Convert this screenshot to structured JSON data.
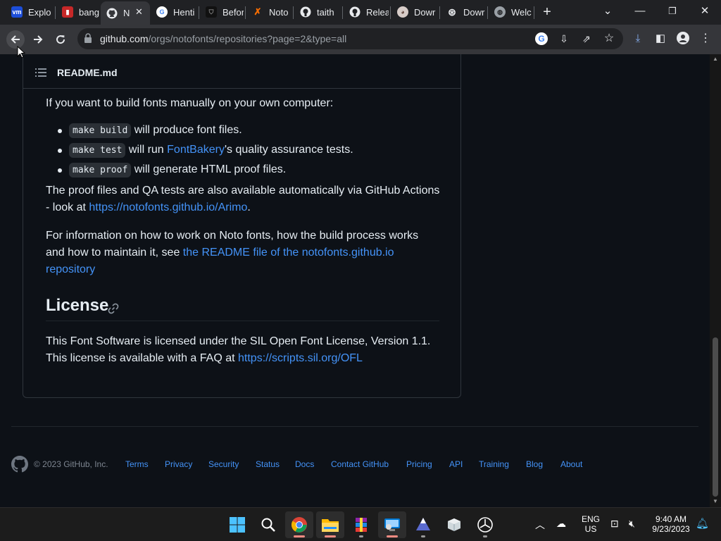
{
  "browser": {
    "tabs": [
      {
        "title": "Explo",
        "favicon": "vmware-icon",
        "color": "#1d4ed8"
      },
      {
        "title": "bang",
        "favicon": "bookmark-icon",
        "color": "#c62828"
      },
      {
        "title": "N",
        "favicon": "github-icon",
        "color": "#e8eaed",
        "active": true
      },
      {
        "title": "Henti",
        "favicon": "google-icon",
        "color": "#ffffff"
      },
      {
        "title": "Befor",
        "favicon": "shield-icon",
        "color": "#111111"
      },
      {
        "title": "Noto",
        "favicon": "xcode-icon",
        "color": "#ff6f00"
      },
      {
        "title": "taith",
        "favicon": "github-icon",
        "color": "#e8eaed"
      },
      {
        "title": "Relea",
        "favicon": "github-icon",
        "color": "#e8eaed"
      },
      {
        "title": "Dowr",
        "favicon": "mascot-icon",
        "color": "#d7ccc8"
      },
      {
        "title": "Dowr",
        "favicon": "openai-icon",
        "color": "#e8eaed"
      },
      {
        "title": "Welc",
        "favicon": "globe-icon",
        "color": "#e8eaed"
      }
    ],
    "url_host": "github.com",
    "url_path": "/orgs/notofonts/repositories?page=2&type=all"
  },
  "readme": {
    "filename": "README.md",
    "intro": "If you want to build fonts manually on your own computer:",
    "bullets": [
      {
        "code": "make build",
        "text": " will produce font files."
      },
      {
        "code": "make test",
        "pre": " will run ",
        "link": "FontBakery",
        "text": "'s quality assurance tests."
      },
      {
        "code": "make proof",
        "text": " will generate HTML proof files."
      }
    ],
    "proof_p1": "The proof files and QA tests are also available automatically via GitHub Actions",
    "proof_p2_pre": "- look at ",
    "proof_link": "https://notofonts.github.io/Arimo",
    "proof_p2_post": ".",
    "info_p1": "For information on how to work on Noto fonts, how the build process works",
    "info_p2_pre": "and how to maintain it, see ",
    "info_link_1": "the README file of the notofonts.github.io",
    "info_link_2": "repository",
    "license_heading": "License",
    "license_p1": "This Font Software is licensed under the SIL Open Font License, Version 1.1.",
    "license_p2_pre": "This license is available with a FAQ at ",
    "license_link": "https://scripts.sil.org/OFL"
  },
  "footer": {
    "copyright": "© 2023 GitHub, Inc.",
    "links": [
      "Terms",
      "Privacy",
      "Security",
      "Status",
      "Docs",
      "Contact GitHub",
      "Pricing",
      "API",
      "Training",
      "Blog",
      "About"
    ]
  },
  "taskbar": {
    "language_1": "ENG",
    "language_2": "US",
    "time": "9:40 AM",
    "date": "9/23/2023"
  }
}
